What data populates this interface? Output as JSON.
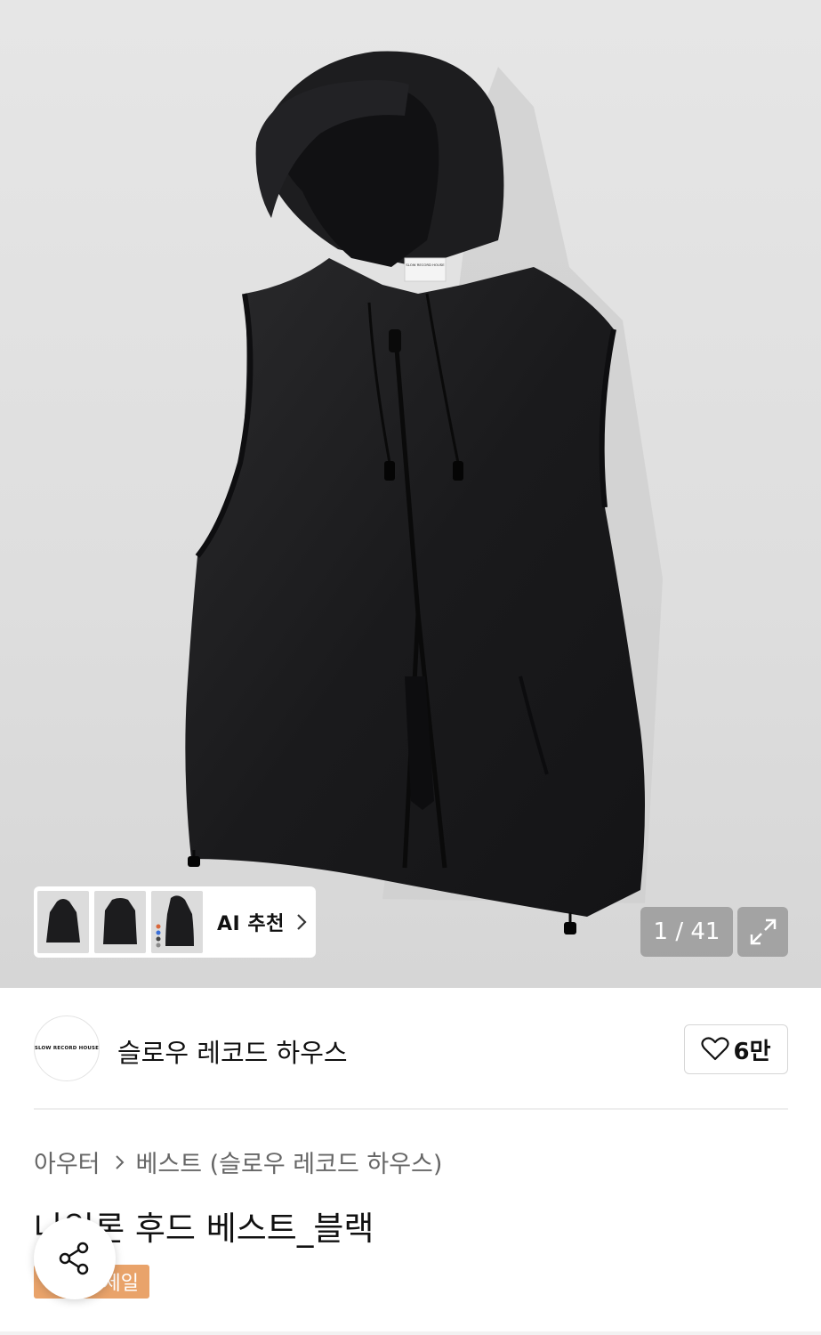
{
  "gallery": {
    "counter": "1 / 41",
    "ai_label": "AI 추천",
    "garment_label_text": "SLOW RECORD HOUSE"
  },
  "brand": {
    "logo_text": "SLOW RECORD HOUSE",
    "name": "슬로우 레코드 하우스"
  },
  "like": {
    "count": "6만"
  },
  "breadcrumb": {
    "category": "아우터",
    "subcategory": "베스트 (슬로우 레코드 하우스)"
  },
  "product": {
    "title": "나일론 후드 베스트_블랙",
    "badge": "세일"
  },
  "colors": {
    "badge": "#e9a36a",
    "vest": "#1c1c1e",
    "background": "#e2e2e2"
  }
}
